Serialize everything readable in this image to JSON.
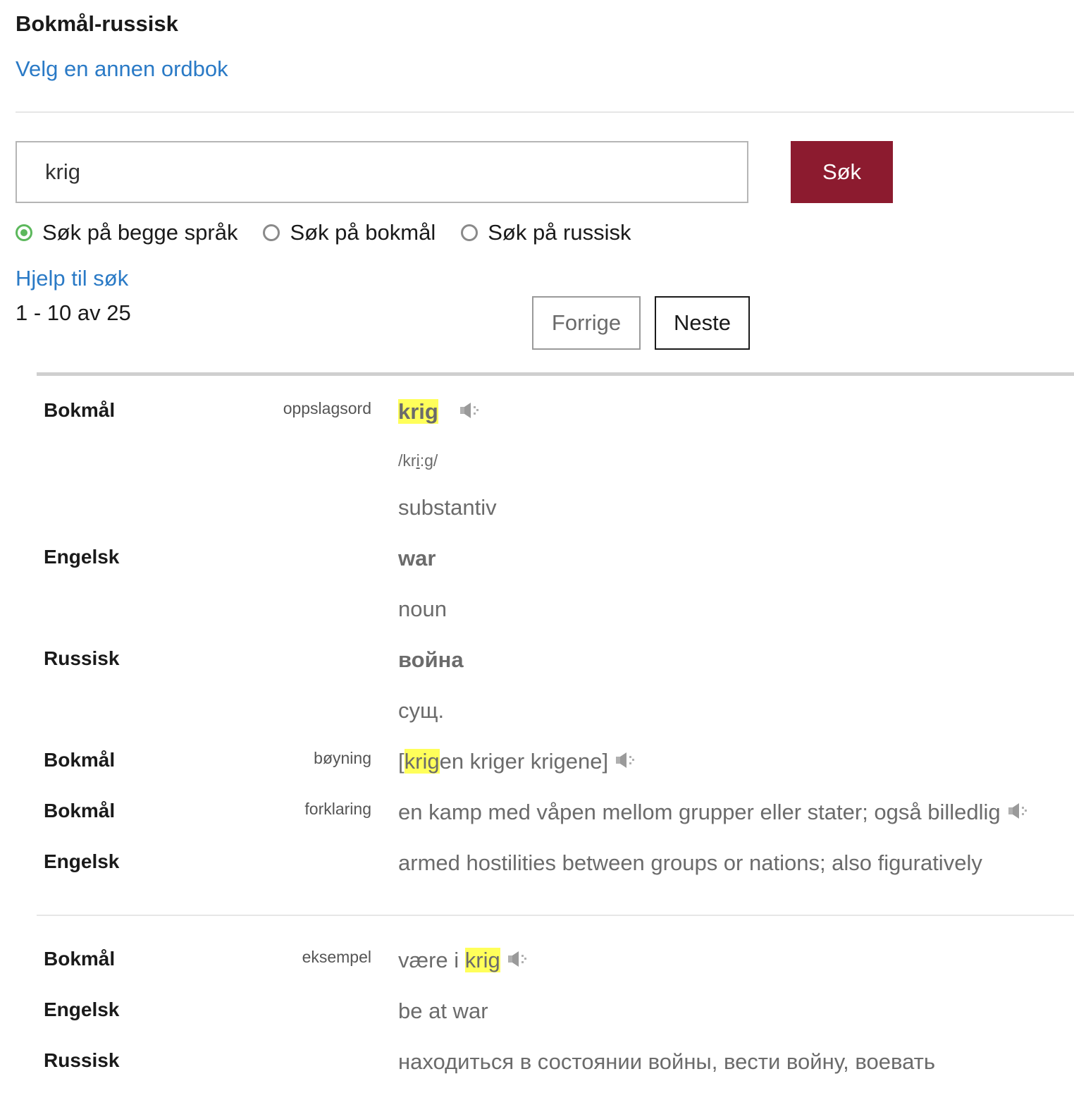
{
  "header": {
    "title": "Bokmål-russisk",
    "choose_dictionary_link": "Velg en annen ordbok"
  },
  "search": {
    "value": "krig",
    "button_label": "Søk",
    "options": [
      {
        "label": "Søk på begge språk",
        "checked": true
      },
      {
        "label": "Søk på bokmål",
        "checked": false
      },
      {
        "label": "Søk på russisk",
        "checked": false
      }
    ],
    "help_link": "Hjelp til søk"
  },
  "results": {
    "count_text": "1 - 10 av 25",
    "prev_label": "Forrige",
    "next_label": "Neste"
  },
  "entry1": {
    "headword": {
      "lang": "Bokmål",
      "type": "oppslagsord",
      "word": "krig",
      "pron_before": "/kr",
      "pron_underlined": "i",
      "pron_after": ":g/",
      "pos": "substantiv"
    },
    "english": {
      "lang": "Engelsk",
      "word": "war",
      "pos": "noun"
    },
    "russian": {
      "lang": "Russisk",
      "word": "война",
      "pos": "сущ."
    },
    "inflection": {
      "lang": "Bokmål",
      "type": "bøyning",
      "open": "[",
      "hl": "krig",
      "rest": "en kriger krigene]"
    },
    "definition": {
      "lang": "Bokmål",
      "type": "forklaring",
      "text": "en kamp med våpen mellom grupper eller stater; også billedlig"
    },
    "definition_en": {
      "lang": "Engelsk",
      "text": "armed hostilities between groups or nations; also figuratively"
    }
  },
  "entry2": {
    "example": {
      "lang": "Bokmål",
      "type": "eksempel",
      "before": "være i ",
      "hl": "krig"
    },
    "english": {
      "lang": "Engelsk",
      "text": "be at war"
    },
    "russian": {
      "lang": "Russisk",
      "text": "находиться в состоянии войны, вести войну, воевать"
    }
  },
  "icons": {
    "speaker": "speaker-icon",
    "radio": "radio-button-icon"
  },
  "colors": {
    "link": "#2a7ac6",
    "search_button": "#8c1b2f",
    "highlight": "#ffff5a",
    "radio_checked": "#5cb85c"
  }
}
